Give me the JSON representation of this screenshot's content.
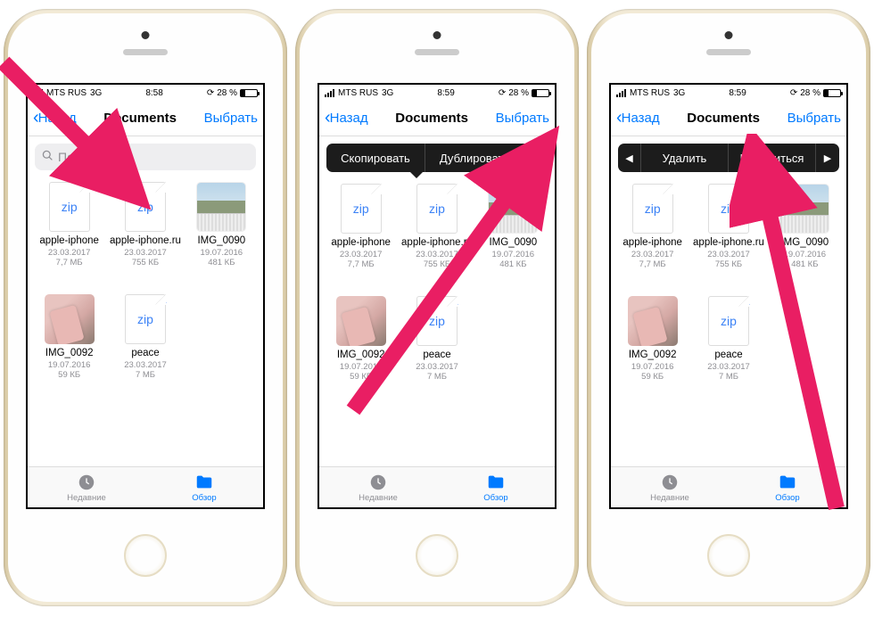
{
  "statusbar": {
    "carrier": "MTS RUS",
    "network": "3G",
    "time1": "8:58",
    "time2": "8:59",
    "time3": "8:59",
    "battery_pct": "28 %",
    "battery_fill": "28%"
  },
  "navbar": {
    "back": "Назад",
    "title": "Documents",
    "select": "Выбрать"
  },
  "search": {
    "placeholder": "Поиск"
  },
  "context_menu_a": {
    "copy": "Скопировать",
    "duplicate": "Дублировать"
  },
  "context_menu_b": {
    "delete": "Удалить",
    "share": "Поделиться"
  },
  "files": [
    {
      "kind": "zip",
      "name": "apple-iphone",
      "date": "23.03.2017",
      "size": "7,7 МБ"
    },
    {
      "kind": "zip",
      "name": "apple-iphone.ru",
      "date": "23.03.2017",
      "size": "755 КБ"
    },
    {
      "kind": "img_kb",
      "name": "IMG_0090",
      "date": "19.07.2016",
      "size": "481 КБ"
    },
    {
      "kind": "img_phone",
      "name": "IMG_0092",
      "date": "19.07.2016",
      "size": "59 КБ"
    },
    {
      "kind": "zip_cloud",
      "name": "peace",
      "date": "23.03.2017",
      "size": "7 МБ"
    }
  ],
  "tabs": {
    "recent": "Недавние",
    "browse": "Обзор"
  },
  "icons": {
    "zip": "zip"
  },
  "ctx_pointer": {
    "p2_left_pct": "38%",
    "p3_left_pct": "58%"
  }
}
